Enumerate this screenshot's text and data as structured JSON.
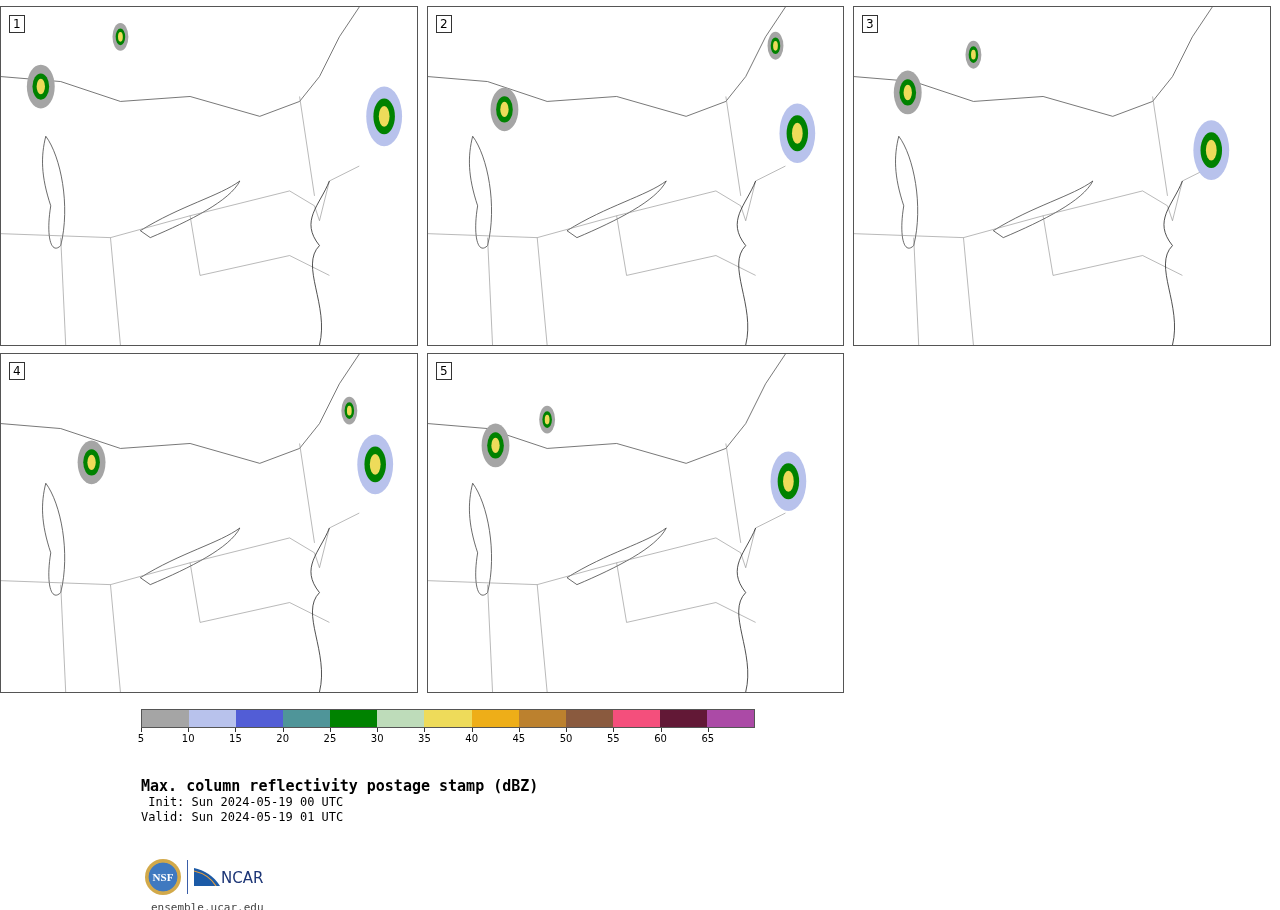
{
  "panels": [
    {
      "label": "1"
    },
    {
      "label": "2"
    },
    {
      "label": "3"
    },
    {
      "label": "4"
    },
    {
      "label": "5"
    }
  ],
  "colorbar": {
    "bins": [
      {
        "label": "5",
        "color": "#a5a5a5"
      },
      {
        "label": "10",
        "color": "#b8c2ec"
      },
      {
        "label": "15",
        "color": "#525dd6"
      },
      {
        "label": "20",
        "color": "#4f9599"
      },
      {
        "label": "25",
        "color": "#008200"
      },
      {
        "label": "30",
        "color": "#bedcba"
      },
      {
        "label": "35",
        "color": "#eedb5a"
      },
      {
        "label": "40",
        "color": "#eeae18"
      },
      {
        "label": "45",
        "color": "#bc812e"
      },
      {
        "label": "50",
        "color": "#8a5a3e"
      },
      {
        "label": "55",
        "color": "#f44f7c"
      },
      {
        "label": "60",
        "color": "#621836"
      },
      {
        "label": "65",
        "color": "#ab4aa6"
      }
    ]
  },
  "title": "Max. column reflectivity postage stamp (dBZ)",
  "init": " Init: Sun 2024-05-19 00 UTC",
  "valid": "Valid: Sun 2024-05-19 01 UTC",
  "logos": {
    "nsf": "NSF",
    "ncar": "NCAR"
  },
  "url": "ensemble.ucar.edu"
}
